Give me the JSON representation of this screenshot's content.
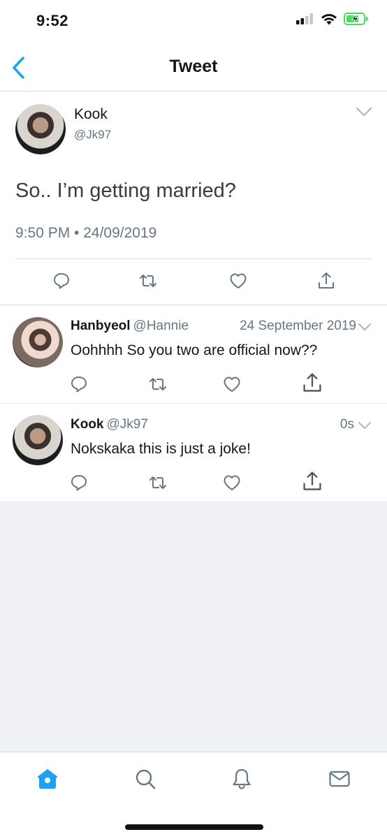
{
  "status": {
    "time": "9:52"
  },
  "nav": {
    "title": "Tweet"
  },
  "main_tweet": {
    "name": "Kook",
    "handle": "@Jk97",
    "text": "So.. I’m getting married?",
    "meta": "9:50 PM • 24/09/2019"
  },
  "replies": [
    {
      "name": "Hanbyeol",
      "handle": "@Hannie",
      "date": "24 September 2019",
      "text": "Oohhhh So you two are official now??"
    },
    {
      "name": "Kook",
      "handle": "@Jk97",
      "date": "0s",
      "text": "Nokskaka this is just a joke!"
    }
  ],
  "icons": [
    "back-chevron",
    "reply",
    "retweet",
    "like",
    "share",
    "home",
    "search",
    "notifications",
    "messages"
  ],
  "colors": {
    "accent": "#1da1f2",
    "secondary_text": "#657786",
    "icon_gray": "#657786",
    "divider": "#d8dde1",
    "empty_bg": "#eff1f4"
  }
}
